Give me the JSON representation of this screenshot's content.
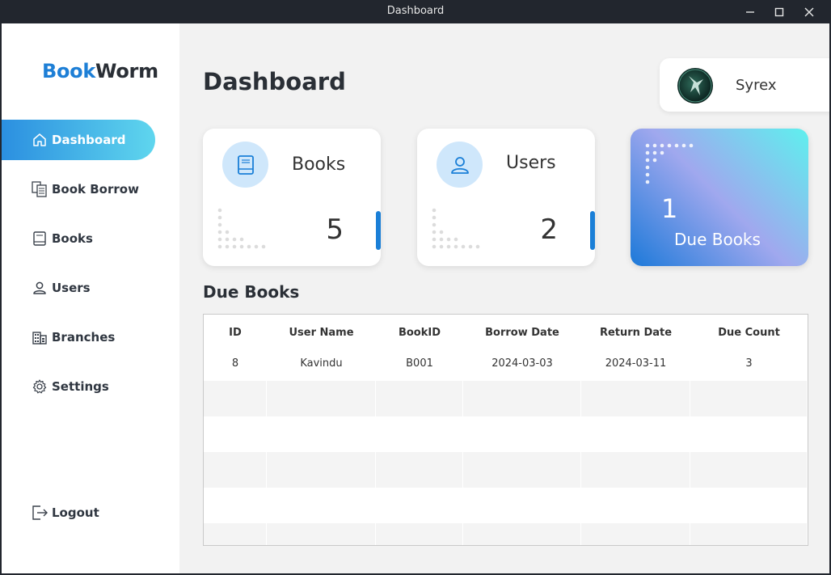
{
  "window": {
    "title": "Dashboard"
  },
  "brand": {
    "part1": "Book",
    "part2": "Worm",
    "color1": "#1e7fd6",
    "color2": "#2a2f36"
  },
  "sidebar": {
    "items": [
      {
        "label": "Dashboard",
        "icon": "home-icon",
        "active": true
      },
      {
        "label": "Book Borrow",
        "icon": "book-borrow-icon",
        "active": false
      },
      {
        "label": "Books",
        "icon": "book-icon",
        "active": false
      },
      {
        "label": "Users",
        "icon": "user-icon",
        "active": false
      },
      {
        "label": "Branches",
        "icon": "building-icon",
        "active": false
      },
      {
        "label": "Settings",
        "icon": "gear-icon",
        "active": false
      }
    ],
    "logout": {
      "label": "Logout",
      "icon": "logout-icon"
    }
  },
  "header": {
    "title": "Dashboard"
  },
  "profile": {
    "name": "Syrex",
    "avatar": "avatar"
  },
  "cards": {
    "books": {
      "label": "Books",
      "value": "5",
      "icon": "book-icon"
    },
    "users": {
      "label": "Users",
      "value": "2",
      "icon": "user-icon"
    },
    "due": {
      "label": "Due Books",
      "value": "1"
    }
  },
  "due_section": {
    "title": "Due Books",
    "columns": [
      "ID",
      "User Name",
      "BookID",
      "Borrow Date",
      "Return Date",
      "Due Count"
    ],
    "rows": [
      [
        "8",
        "Kavindu",
        "B001",
        "2024-03-03",
        "2024-03-11",
        "3"
      ]
    ]
  },
  "colors": {
    "accent": "#1a7fd7",
    "active_nav_start": "#2b8fe0",
    "active_nav_end": "#5fd6ee",
    "icon_bg": "#cfe7fb"
  }
}
